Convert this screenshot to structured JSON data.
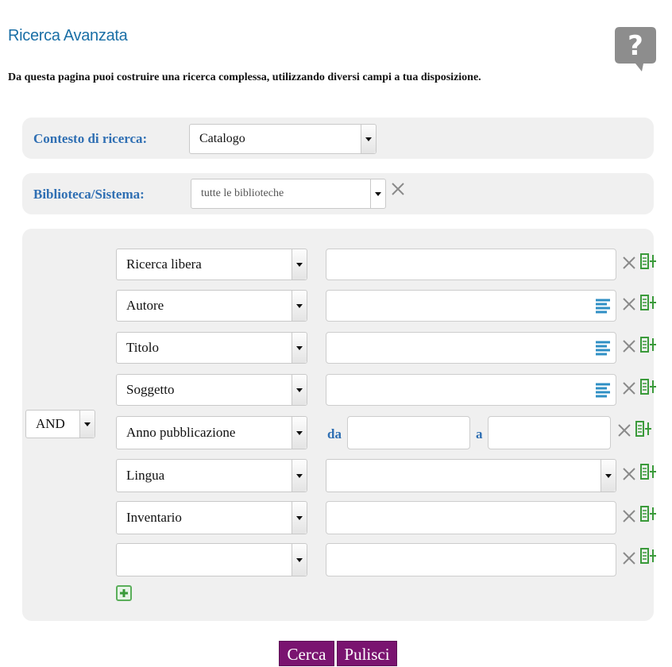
{
  "header": {
    "title": "Ricerca Avanzata",
    "help_icon": "question-mark-speech-bubble",
    "intro": "Da questa pagina puoi costruire una ricerca complessa, utilizzando diversi campi a tua disposizione."
  },
  "context": {
    "label": "Contesto di ricerca:",
    "value": "Catalogo"
  },
  "library": {
    "label": "Biblioteca/Sistema:",
    "value": "tutte le biblioteche"
  },
  "operator": {
    "value": "AND"
  },
  "rows": [
    {
      "field": "Ricerca libera",
      "type": "text",
      "list_icon": false
    },
    {
      "field": "Autore",
      "type": "text",
      "list_icon": true
    },
    {
      "field": "Titolo",
      "type": "text",
      "list_icon": true
    },
    {
      "field": "Soggetto",
      "type": "text",
      "list_icon": true
    },
    {
      "field": "Anno pubblicazione",
      "type": "range",
      "from_label": "da",
      "to_label": "a"
    },
    {
      "field": "Lingua",
      "type": "select"
    },
    {
      "field": "Inventario",
      "type": "text",
      "list_icon": false
    },
    {
      "field": "",
      "type": "text",
      "list_icon": false
    }
  ],
  "actions": {
    "search_label": "Cerca",
    "clear_label": "Pulisci"
  },
  "colors": {
    "title": "#1a6fa6",
    "label": "#2f6fb3",
    "button": "#7a1470",
    "add_icon": "#3a9a3a"
  }
}
